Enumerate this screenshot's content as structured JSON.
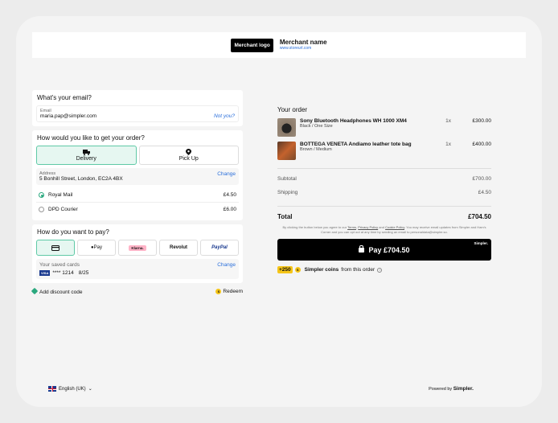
{
  "header": {
    "logo_label": "Merchant logo",
    "merchant_name": "Merchant name",
    "merchant_url": "www.storeurl.com"
  },
  "email": {
    "title": "What's your email?",
    "field_label": "Email",
    "value": "maria.pap@simpler.com",
    "not_you": "Not you?"
  },
  "delivery": {
    "title": "How would you like to get your order?",
    "tabs": [
      {
        "label": "Delivery",
        "icon": "truck-icon"
      },
      {
        "label": "Pick Up",
        "icon": "location-pin-icon"
      }
    ],
    "address_label": "Address",
    "address_value": "5 Bonhill Street, London, EC2A 4BX",
    "change": "Change",
    "options": [
      {
        "name": "Royal Mail",
        "price": "£4.50",
        "selected": true
      },
      {
        "name": "DPD Courier",
        "price": "£6.00",
        "selected": false
      }
    ]
  },
  "payment": {
    "title": "How do you want to pay?",
    "methods": [
      {
        "label": "",
        "icon": "card-icon"
      },
      {
        "label": "Pay",
        "icon": "apple-icon"
      },
      {
        "label": "Klarna."
      },
      {
        "label": "Revolut"
      },
      {
        "label": "PayPal"
      }
    ],
    "saved_label": "Your saved cards",
    "change": "Change",
    "card_brand": "VISA",
    "card_number": "**** 1214",
    "card_expiry": "8/25"
  },
  "discount": {
    "add_label": "Add discount code",
    "redeem_label": "Redeem"
  },
  "order": {
    "title": "Your order",
    "items": [
      {
        "name": "Sony Bluetooth Headphones WH 1000 XM4",
        "variant": "Black / One Size",
        "qty": "1x",
        "price": "£300.00"
      },
      {
        "name": "BOTTEGA VENETA Andiamo leather tote bag",
        "variant": "Brown / Medium",
        "qty": "1x",
        "price": "£400.00"
      }
    ],
    "subtotal_label": "Subtotal",
    "subtotal": "£700.00",
    "shipping_label": "Shipping",
    "shipping": "£4.50",
    "total_label": "Total",
    "total": "£704.50",
    "fine_print_1": "By clicking the button below you agree to our",
    "terms": "Terms",
    "privacy": "Privacy Policy",
    "and": "and",
    "cookie": "Cookie Policy",
    "fine_print_2": ". You may receive email updates from Simpler and Ham's Corner and you can opt out at any time by sending an email to personaldata@simpler.so.",
    "pay_button": "Pay £704.50",
    "simpler_tag": "Simpler.",
    "coins_plus": "+250",
    "coins_text": "Simpler coins",
    "coins_suffix": "from this order"
  },
  "footer": {
    "language": "English (UK)",
    "powered_by": "Powered by",
    "brand": "Simpler."
  },
  "colors": {
    "accent": "#2aa87e",
    "selected_bg": "#e6f7f1",
    "link": "#2a6fdb"
  }
}
